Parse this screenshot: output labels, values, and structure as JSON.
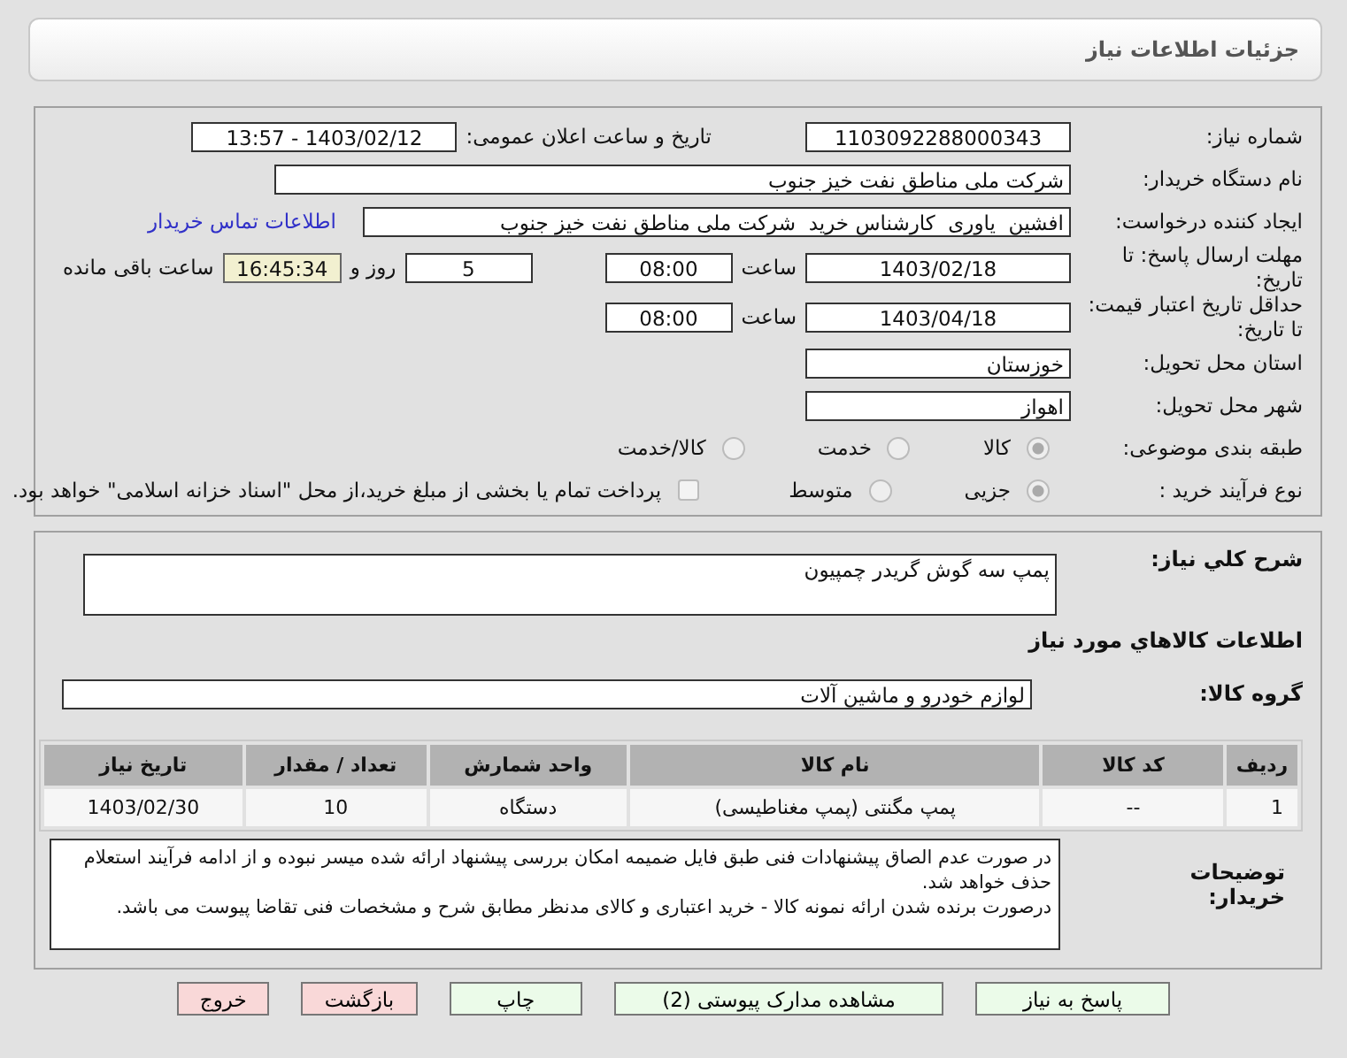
{
  "header": {
    "title": "جزئیات اطلاعات نیاز"
  },
  "need_number": {
    "label": "شماره نیاز:",
    "value": "1103092288000343"
  },
  "announce": {
    "label": "تاریخ و ساعت اعلان عمومی:",
    "value": "1403/02/12 - 13:57"
  },
  "buyer": {
    "label": "نام دستگاه خریدار:",
    "value": "شرکت ملی مناطق نفت خیز جنوب"
  },
  "creator": {
    "label": "ایجاد کننده درخواست:",
    "value": "افشین  یاوری  کارشناس خرید  شرکت ملی مناطق نفت خیز جنوب",
    "link": "اطلاعات تماس خریدار"
  },
  "deadline": {
    "label": "مهلت ارسال پاسخ: تا تاریخ:",
    "date": "1403/02/18",
    "time_label": "ساعت",
    "time": "08:00",
    "days": "5",
    "days_label": "روز و",
    "remaining": "16:45:34",
    "remaining_label": "ساعت باقی مانده"
  },
  "validity": {
    "label": "حداقل تاریخ اعتبار قیمت: تا تاریخ:",
    "date": "1403/04/18",
    "time_label": "ساعت",
    "time": "08:00"
  },
  "province": {
    "label": "استان محل تحویل:",
    "value": "خوزستان"
  },
  "city": {
    "label": "شهر محل تحویل:",
    "value": "اهواز"
  },
  "category": {
    "label": "طبقه بندی موضوعی:",
    "options": [
      {
        "label": "کالا",
        "selected": true
      },
      {
        "label": "خدمت",
        "selected": false
      },
      {
        "label": "کالا/خدمت",
        "selected": false
      }
    ]
  },
  "purchase_type": {
    "label": "نوع فرآیند خرید :",
    "options": [
      {
        "label": "جزیی",
        "selected": true
      },
      {
        "label": "متوسط",
        "selected": false
      }
    ],
    "treasury": {
      "checked": false,
      "label": "پرداخت تمام یا بخشی از مبلغ خرید،از محل \"اسناد خزانه اسلامی\" خواهد بود."
    }
  },
  "description": {
    "label": "شرح کلي نیاز:",
    "value": "پمپ سه گوش گریدر چمپیون"
  },
  "goods_section": {
    "title": "اطلاعات کالاهاي مورد نیاز"
  },
  "goods_group": {
    "label": "گروه کالا:",
    "value": "لوازم خودرو و ماشین آلات"
  },
  "table": {
    "columns": [
      "ردیف",
      "کد کالا",
      "نام کالا",
      "واحد شمارش",
      "تعداد / مقدار",
      "تاریخ نیاز"
    ],
    "rows": [
      [
        "1",
        "--",
        "پمپ مگنتی (پمپ مغناطیسی)",
        "دستگاه",
        "10",
        "1403/02/30"
      ]
    ]
  },
  "notes": {
    "label": "توضیحات خریدار:",
    "paragraphs": [
      "در صورت عدم الصاق پیشنهادات فنی طبق فایل ضمیمه امکان بررسی پیشنهاد ارائه شده میسر نبوده و از ادامه فرآیند استعلام حذف خواهد شد.",
      "درصورت برنده شدن ارائه نمونه کالا - خرید اعتباری و کالای مدنظر مطابق شرح و مشخصات فنی تقاضا پیوست می باشد."
    ]
  },
  "buttons": [
    {
      "label": "پاسخ به نیاز",
      "kind": "action"
    },
    {
      "label": "مشاهده مدارک پیوستی (2)",
      "kind": "action"
    },
    {
      "label": "چاپ",
      "kind": "action"
    },
    {
      "label": "بازگشت",
      "kind": "leave"
    },
    {
      "label": "خروج",
      "kind": "leave"
    }
  ]
}
